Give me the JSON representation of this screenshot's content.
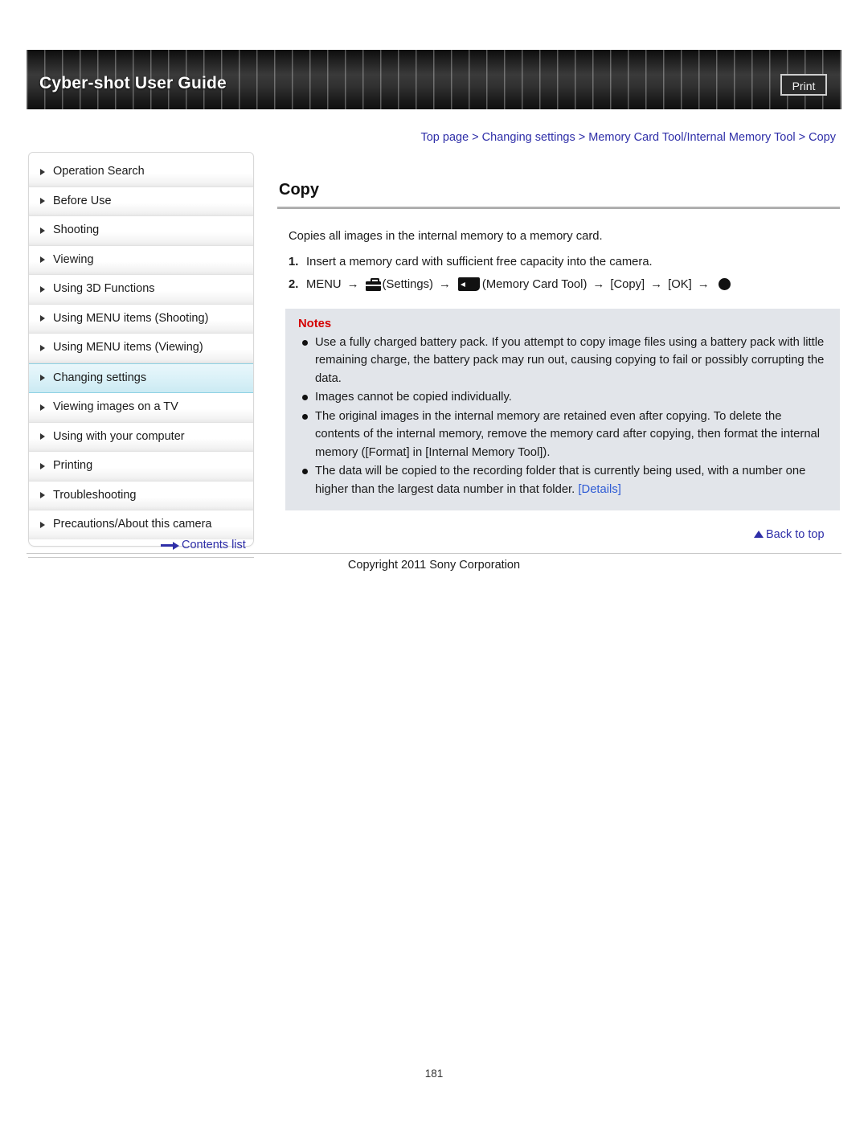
{
  "header": {
    "title": "Cyber-shot User Guide",
    "print_label": "Print"
  },
  "breadcrumb": {
    "text": "Top page > Changing settings > Memory Card Tool/Internal Memory Tool > Copy",
    "color": "#2e2ea8"
  },
  "sidebar": {
    "items": [
      {
        "label": "Operation Search",
        "active": false
      },
      {
        "label": "Before Use",
        "active": false
      },
      {
        "label": "Shooting",
        "active": false
      },
      {
        "label": "Viewing",
        "active": false
      },
      {
        "label": "Using 3D Functions",
        "active": false
      },
      {
        "label": "Using MENU items (Shooting)",
        "active": false
      },
      {
        "label": "Using MENU items (Viewing)",
        "active": false
      },
      {
        "label": "Changing settings",
        "active": true
      },
      {
        "label": "Viewing images on a TV",
        "active": false
      },
      {
        "label": "Using with your computer",
        "active": false
      },
      {
        "label": "Printing",
        "active": false
      },
      {
        "label": "Troubleshooting",
        "active": false
      },
      {
        "label": "Precautions/About this camera",
        "active": false
      }
    ],
    "contents_list_label": "Contents list",
    "contents_list_icon": "right-arrow-icon",
    "active_color": "#cbeaf3"
  },
  "main": {
    "title": "Copy",
    "intro": "Copies all images in the internal memory to a memory card.",
    "steps": [
      {
        "number": "1.",
        "text": "Insert a memory card with sufficient free capacity into the camera."
      },
      {
        "number": "2.",
        "menu_label": "MENU",
        "settings_label": "(Settings)",
        "settings_icon": "toolbox-settings-icon",
        "card_tool_label": "(Memory Card Tool)",
        "card_tool_icon": "memory-card-icon",
        "copy_label": "[Copy]",
        "ok_label": "[OK]",
        "shutter_icon": "shutter-button-icon",
        "arrow": "→"
      }
    ],
    "notes": {
      "title": "Notes",
      "title_color": "#d40000",
      "background": "#e2e5ea",
      "items": [
        "Use a fully charged battery pack. If you attempt to copy image files using a battery pack with little remaining charge, the battery pack may run out, causing copying to fail or possibly corrupting the data.",
        "Images cannot be copied individually.",
        "The original images in the internal memory are retained even after copying. To delete the contents of the internal memory, remove the memory card after copying, then format the internal memory ([Format] in [Internal Memory Tool]).",
        "The data will be copied to the recording folder that is currently being used, with a number one higher than the largest data number in that folder."
      ],
      "last_item_link": "[Details]",
      "link_color": "#2e5bd4"
    }
  },
  "footer": {
    "back_to_top_label": "Back to top",
    "back_to_top_icon": "up-triangle-icon",
    "copyright": "Copyright 2011 Sony Corporation",
    "page_number": "181"
  }
}
